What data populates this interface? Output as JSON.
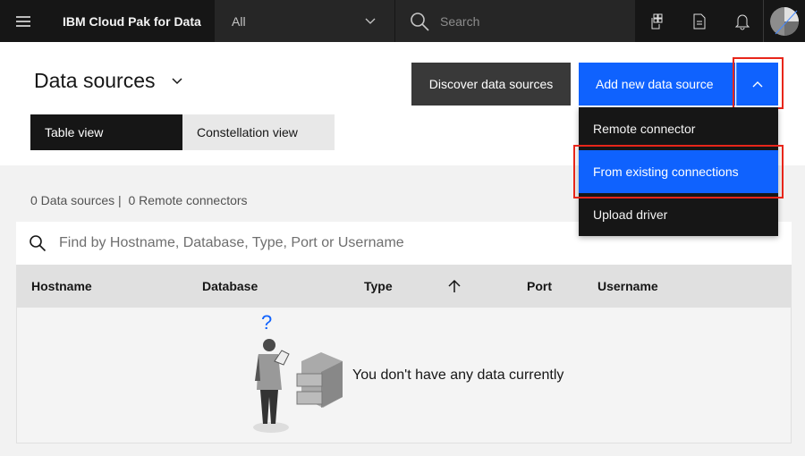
{
  "header": {
    "brand": "IBM Cloud Pak for Data",
    "scope": "All",
    "search_placeholder": "Search",
    "icons": [
      "menu-icon",
      "catalog-icon",
      "document-icon",
      "notification-icon",
      "avatar"
    ]
  },
  "page": {
    "title": "Data sources",
    "discover": "Discover data sources",
    "add": "Add new data source",
    "views": [
      "Table view",
      "Constellation view"
    ],
    "active_view": "Table view"
  },
  "menu": {
    "items": [
      "Remote connector",
      "From existing connections",
      "Upload driver"
    ],
    "highlighted": "From existing connections"
  },
  "summary": {
    "data_sources": "0 Data sources |",
    "remote": "0 Remote connectors"
  },
  "table": {
    "search_placeholder": "Find by Hostname, Database, Type, Port or Username",
    "columns": [
      "Hostname",
      "Database",
      "Type",
      "Port",
      "Username"
    ],
    "sort_icon": "arrow-up-icon",
    "empty": "You don't have any data currently"
  },
  "colors": {
    "accent": "#0f62fe",
    "highlight": "#e8261a"
  }
}
